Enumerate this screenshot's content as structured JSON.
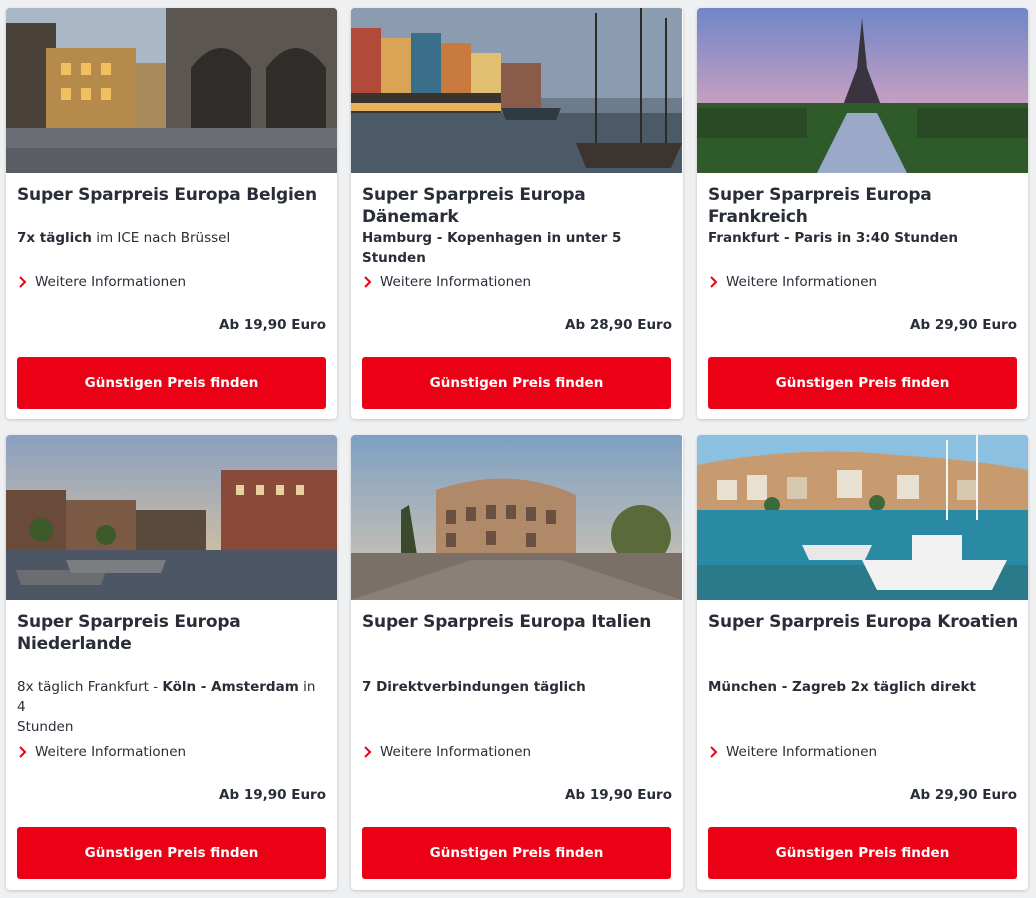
{
  "cards": [
    {
      "image": "grand-place-brussels",
      "title": "Super Sparpreis Europa Belgien",
      "desc_bold": "7x täglich",
      "desc_rest": " im ICE nach Brüssel",
      "more": "Weitere Informationen",
      "price": "Ab 19,90 Euro",
      "button": "Günstigen Preis finden"
    },
    {
      "image": "nyhavn-copenhagen",
      "title": "Super Sparpreis Europa Dänemark",
      "desc_bold": "Hamburg - Kopenhagen in unter 5 Stunden",
      "desc_rest": "",
      "more": "Weitere Informationen",
      "price": "Ab 28,90 Euro",
      "button": "Günstigen Preis finden"
    },
    {
      "image": "eiffel-tower-paris",
      "title": "Super Sparpreis Europa Frankreich",
      "desc_bold": "Frankfurt - Paris in 3:40 Stunden",
      "desc_rest": "",
      "more": "Weitere Informationen",
      "price": "Ab 29,90 Euro",
      "button": "Günstigen Preis finden"
    },
    {
      "image": "amsterdam-canal",
      "title_line1": "Super Sparpreis Europa",
      "title_line2": "Niederlande",
      "desc_a": "8x täglich Frankfurt - ",
      "desc_b": "Köln - Amsterdam",
      "desc_c": " in 4",
      "desc_d": "Stunden",
      "more": "Weitere Informationen",
      "price": "Ab 19,90 Euro",
      "button": "Günstigen Preis finden"
    },
    {
      "image": "colosseum-rome",
      "title": "Super Sparpreis Europa Italien",
      "desc_bold": "7 Direktverbindungen täglich",
      "desc_rest": "",
      "more": "Weitere Informationen",
      "price": "Ab 19,90 Euro",
      "button": "Günstigen Preis finden"
    },
    {
      "image": "croatian-harbor",
      "title": "Super Sparpreis Europa Kroatien",
      "desc_bold": "München - Zagreb 2x täglich direkt",
      "desc_rest": "",
      "more": "Weitere Informationen",
      "price": "Ab 29,90 Euro",
      "button": "Günstigen Preis finden"
    }
  ],
  "colors": {
    "accent": "#ec0016",
    "text": "#282d37",
    "background": "#eef0f2"
  }
}
